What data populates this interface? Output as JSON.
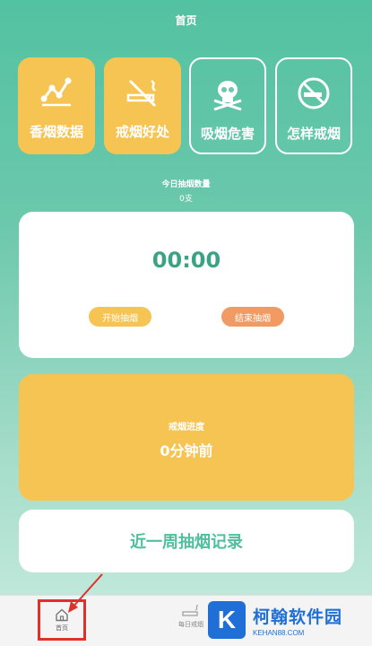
{
  "header": {
    "title": "首页"
  },
  "tiles": [
    {
      "label": "香烟数据",
      "icon": "chart-line-icon",
      "style": "filled"
    },
    {
      "label": "戒烟好处",
      "icon": "no-smoking-icon",
      "style": "filled"
    },
    {
      "label": "吸烟危害",
      "icon": "skull-icon",
      "style": "outline"
    },
    {
      "label": "怎样戒烟",
      "icon": "quit-smoking-icon",
      "style": "outline"
    }
  ],
  "today": {
    "label": "今日抽烟数量",
    "value": "0支"
  },
  "timer": {
    "display": "00:00",
    "start_label": "开始抽烟",
    "end_label": "结束抽烟"
  },
  "progress": {
    "label": "戒烟进度",
    "value": "0分钟前"
  },
  "record": {
    "label": "近一周抽烟记录"
  },
  "tabbar": {
    "home_label": "首页",
    "home_icon": "home-icon",
    "second_label": "每日戒烟",
    "second_icon": "cigarette-icon"
  },
  "watermark": {
    "letter": "K",
    "name": "柯翰软件园",
    "url": "KEHAN88.COM"
  },
  "colors": {
    "primary": "#53c2a1",
    "accent_yellow": "#f6c452",
    "accent_orange": "#f29a63",
    "timer_text": "#3aa383",
    "highlight_red": "#e0302a",
    "watermark_blue": "#1f6fd6"
  }
}
